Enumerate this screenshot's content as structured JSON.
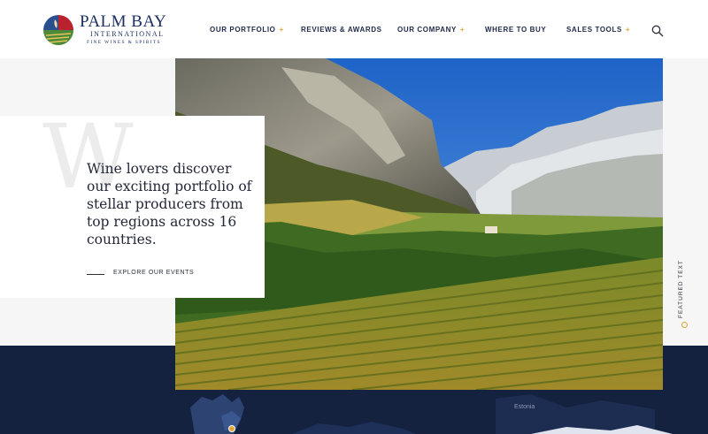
{
  "brand": {
    "name": "PALM BAY",
    "sub1": "INTERNATIONAL",
    "sub2": "FINE WINES & SPIRITS"
  },
  "nav": {
    "items": [
      {
        "label": "OUR PORTFOLIO",
        "plus": "+"
      },
      {
        "label": "REVIEWS & AWARDS",
        "plus": ""
      },
      {
        "label": "OUR COMPANY",
        "plus": "+"
      },
      {
        "label": "WHERE TO BUY",
        "plus": ""
      },
      {
        "label": "SALES TOOLS",
        "plus": "+"
      }
    ]
  },
  "hero": {
    "decorative_letter": "W",
    "headline": "Wine lovers discover our exciting portfolio of stellar producers from top regions across 16 countries.",
    "cta": "EXPLORE OUR EVENTS",
    "side_label": "FEATURED TEXT"
  },
  "map": {
    "label": "Estonia"
  },
  "colors": {
    "navy": "#14213f",
    "accent": "#e0a63a",
    "brand": "#1b2f63"
  },
  "icons": {
    "search": "search-icon",
    "logo": "vineyard-logo-icon"
  }
}
